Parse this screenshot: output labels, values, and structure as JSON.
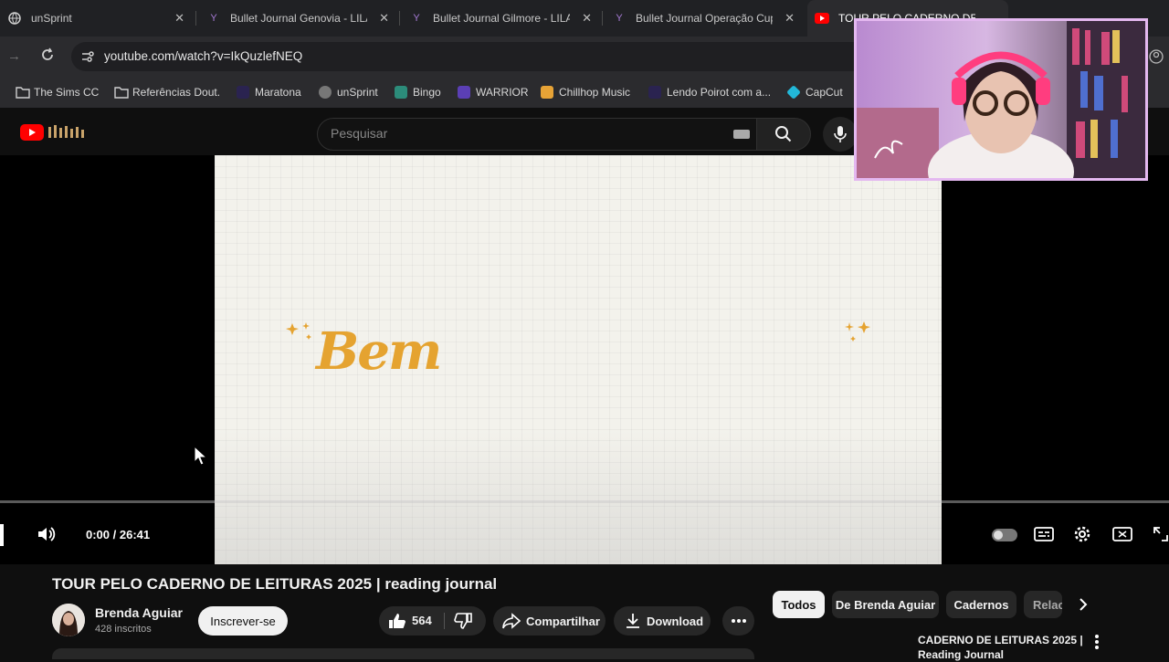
{
  "browser": {
    "tabs": [
      {
        "title": "unSprint"
      },
      {
        "title": "Bullet Journal Genovia - LILA"
      },
      {
        "title": "Bullet Journal Gilmore - LILA"
      },
      {
        "title": "Bullet Journal Operação Cup"
      },
      {
        "title": "TOUR PELO CADERNO DE L"
      }
    ],
    "url": "youtube.com/watch?v=IkQuzlefNEQ",
    "bookmarks": [
      {
        "label": "The Sims CC",
        "icon": "folder-icon"
      },
      {
        "label": "Referências Dout.",
        "icon": "folder-icon"
      },
      {
        "label": "Maratona",
        "icon": "cat-icon"
      },
      {
        "label": "unSprint",
        "icon": "globe-icon"
      },
      {
        "label": "Bingo",
        "icon": "bingo-icon"
      },
      {
        "label": "WARRIOR",
        "icon": "warrior-icon"
      },
      {
        "label": "Chillhop Music",
        "icon": "chillhop-icon"
      },
      {
        "label": "Lendo Poirot com a...",
        "icon": "cat-icon"
      },
      {
        "label": "CapCut",
        "icon": "capcut-icon"
      }
    ]
  },
  "youtube": {
    "search_placeholder": "Pesquisar"
  },
  "video": {
    "overlay_text": "Bem",
    "time": "0:00 / 26:41",
    "progress": 0
  },
  "meta": {
    "title": "TOUR PELO CADERNO DE LEITURAS 2025 | reading journal",
    "channel": "Brenda Aguiar",
    "subscribers": "428 inscritos",
    "subscribe_label": "Inscrever-se",
    "likes": "564",
    "share_label": "Compartilhar",
    "download_label": "Download"
  },
  "chips": [
    "Todos",
    "De Brenda Aguiar",
    "Cadernos",
    "Relac"
  ],
  "sidebar_video_title": "CADERNO DE LEITURAS 2025 | Reading Journal",
  "colors": {
    "youtube_red": "#ff0000",
    "bem_gold": "#e5a330",
    "cam_border": "#e4b8f0"
  }
}
